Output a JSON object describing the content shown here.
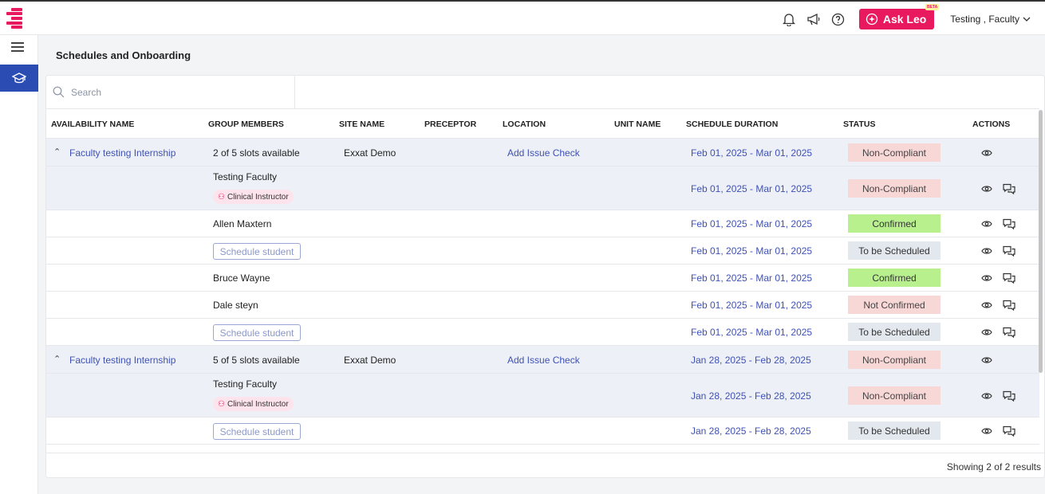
{
  "header": {
    "ask_label": "Ask Leo",
    "beta_label": "BETA",
    "user_name": "Testing , Faculty"
  },
  "page": {
    "title": "Schedules and Onboarding"
  },
  "search": {
    "placeholder": "Search",
    "value": ""
  },
  "columns": {
    "availability": "AVAILABILITY NAME",
    "members": "GROUP MEMBERS",
    "site": "SITE NAME",
    "preceptor": "PRECEPTOR",
    "location": "LOCATION",
    "unit": "UNIT NAME",
    "duration": "SCHEDULE DURATION",
    "status": "STATUS",
    "actions": "ACTIONS"
  },
  "groups": [
    {
      "name": "Faculty testing Internship",
      "slots": "2 of 5 slots available",
      "site": "Exxat Demo",
      "location": "Add Issue Check",
      "duration": "Feb 01, 2025 - Mar 01, 2025",
      "status": "Non-Compliant",
      "members": [
        {
          "name": "Testing Faculty",
          "role": "Clinical Instructor",
          "duration": "Feb 01, 2025 - Mar 01, 2025",
          "status": "Non-Compliant"
        },
        {
          "name": "Allen Maxtern",
          "duration": "Feb 01, 2025 - Mar 01, 2025",
          "status": "Confirmed"
        },
        {
          "button": "Schedule student",
          "duration": "Feb 01, 2025 - Mar 01, 2025",
          "status": "To be Scheduled"
        },
        {
          "name": "Bruce Wayne",
          "duration": "Feb 01, 2025 - Mar 01, 2025",
          "status": "Confirmed"
        },
        {
          "name": "Dale steyn",
          "duration": "Feb 01, 2025 - Mar 01, 2025",
          "status": "Not Confirmed"
        },
        {
          "button": "Schedule student",
          "duration": "Feb 01, 2025 - Mar 01, 2025",
          "status": "To be Scheduled"
        }
      ]
    },
    {
      "name": "Faculty testing Internship",
      "slots": "5 of 5 slots available",
      "site": "Exxat Demo",
      "location": "Add Issue Check",
      "duration": "Jan 28, 2025 - Feb 28, 2025",
      "status": "Non-Compliant",
      "members": [
        {
          "name": "Testing Faculty",
          "role": "Clinical Instructor",
          "duration": "Jan 28, 2025 - Feb 28, 2025",
          "status": "Non-Compliant"
        },
        {
          "button": "Schedule student",
          "duration": "Jan 28, 2025 - Feb 28, 2025",
          "status": "To be Scheduled"
        }
      ]
    }
  ],
  "footer": {
    "results": "Showing 2 of 2 results"
  },
  "colors": {
    "brand": "#e8195e",
    "nav_active": "#2b4db3",
    "link": "#3f51b5",
    "noncompliant": "#f8d7d7",
    "confirmed": "#b8f08e",
    "scheduled": "#e3e8ee"
  }
}
